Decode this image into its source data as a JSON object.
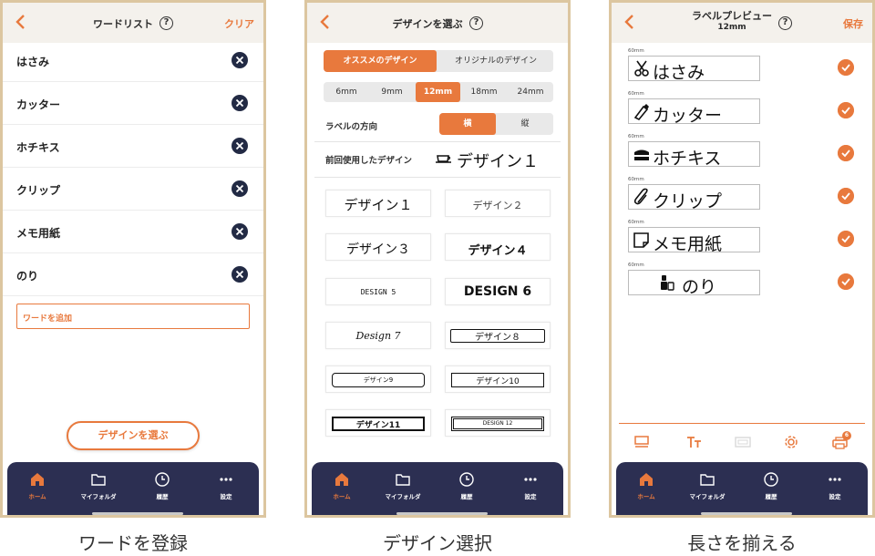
{
  "colors": {
    "accent": "#e8793d",
    "tabbar": "#2c2f52",
    "frame": "#dcc6a0"
  },
  "tabs": [
    {
      "label": "ホーム",
      "icon": "home-icon"
    },
    {
      "label": "マイフォルダ",
      "icon": "folder-icon"
    },
    {
      "label": "履歴",
      "icon": "clock-icon"
    },
    {
      "label": "設定",
      "icon": "more-icon"
    }
  ],
  "screen1": {
    "title": "ワードリスト",
    "action": "クリア",
    "words": [
      "はさみ",
      "カッター",
      "ホチキス",
      "クリップ",
      "メモ用紙",
      "のり"
    ],
    "add_placeholder": "ワードを追加",
    "choose_button": "デザインを選ぶ",
    "caption": "ワードを登録"
  },
  "screen2": {
    "title": "デザインを選ぶ",
    "design_tabs": [
      "オススメのデザイン",
      "オリジナルのデザイン"
    ],
    "widths": [
      "6mm",
      "9mm",
      "12mm",
      "18mm",
      "24mm"
    ],
    "selected_width": "12mm",
    "direction_label": "ラベルの方向",
    "directions": [
      "横",
      "縦"
    ],
    "last_used_label": "前回使用したデザイン",
    "last_used_design": "デザイン１",
    "designs": [
      "デザイン１",
      "デザイン２",
      "デザイン３",
      "デザイン４",
      "DESIGN 5",
      "DESIGN 6",
      "Design 7",
      "デザイン８",
      "デザイン9",
      "デザイン10",
      "デザイン11",
      "DESIGN 12"
    ],
    "caption": "デザイン選択"
  },
  "screen3": {
    "title": "ラベルプレビュー",
    "subtitle": "12mm",
    "action": "保存",
    "labels": [
      {
        "length": "60mm",
        "text": "はさみ",
        "icon": "scissors-icon"
      },
      {
        "length": "60mm",
        "text": "カッター",
        "icon": "cutter-icon"
      },
      {
        "length": "60mm",
        "text": "ホチキス",
        "icon": "stapler-icon"
      },
      {
        "length": "60mm",
        "text": "クリップ",
        "icon": "paperclip-icon"
      },
      {
        "length": "60mm",
        "text": "メモ用紙",
        "icon": "memo-icon"
      },
      {
        "length": "60mm",
        "text": "のり",
        "icon": "glue-icon"
      }
    ],
    "printer_badge": "6",
    "caption": "長さを揃える"
  }
}
